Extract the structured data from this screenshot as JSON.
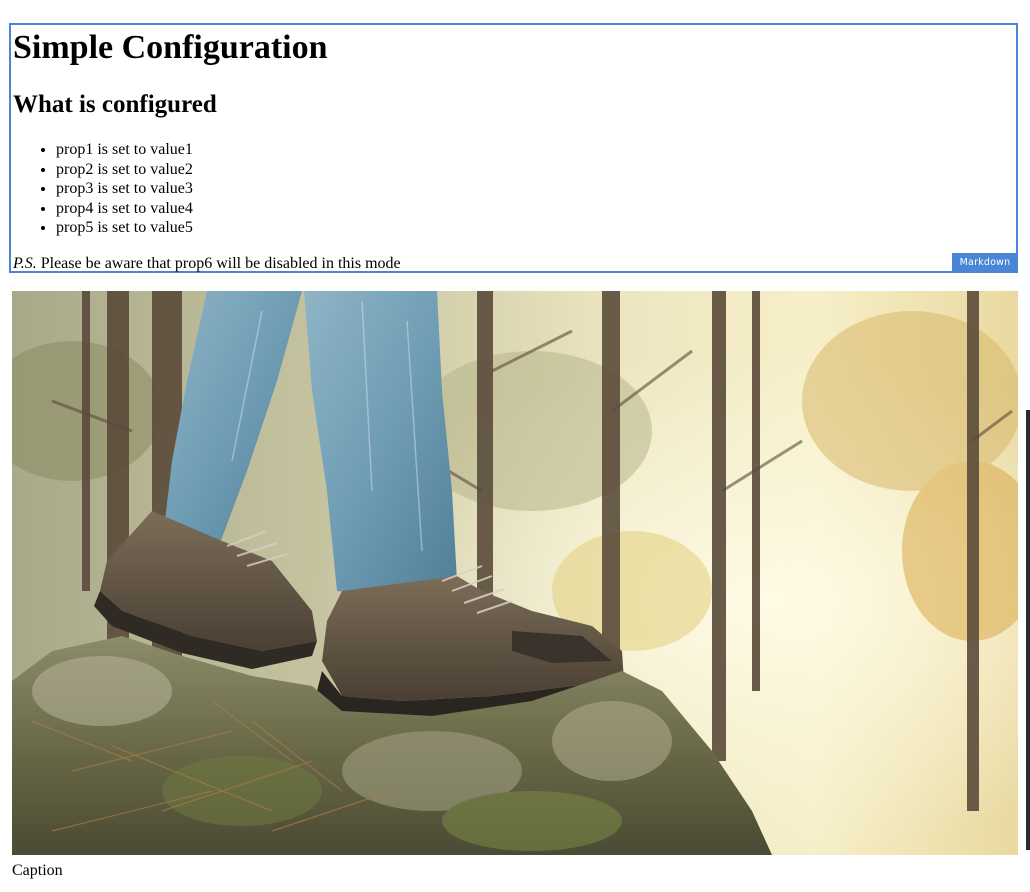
{
  "markdown_cell": {
    "title": "Simple Configuration",
    "subtitle": "What is configured",
    "items": [
      "prop1 is set to value1",
      "prop2 is set to value2",
      "prop3 is set to value3",
      "prop4 is set to value4",
      "prop5 is set to value5"
    ],
    "ps_prefix": "P.S.",
    "ps_text": " Please be aware that prop6 will be disabled in this mode",
    "badge": "Markdown"
  },
  "image_cell": {
    "caption": "Caption"
  },
  "colors": {
    "accent": "#4a86d6"
  }
}
